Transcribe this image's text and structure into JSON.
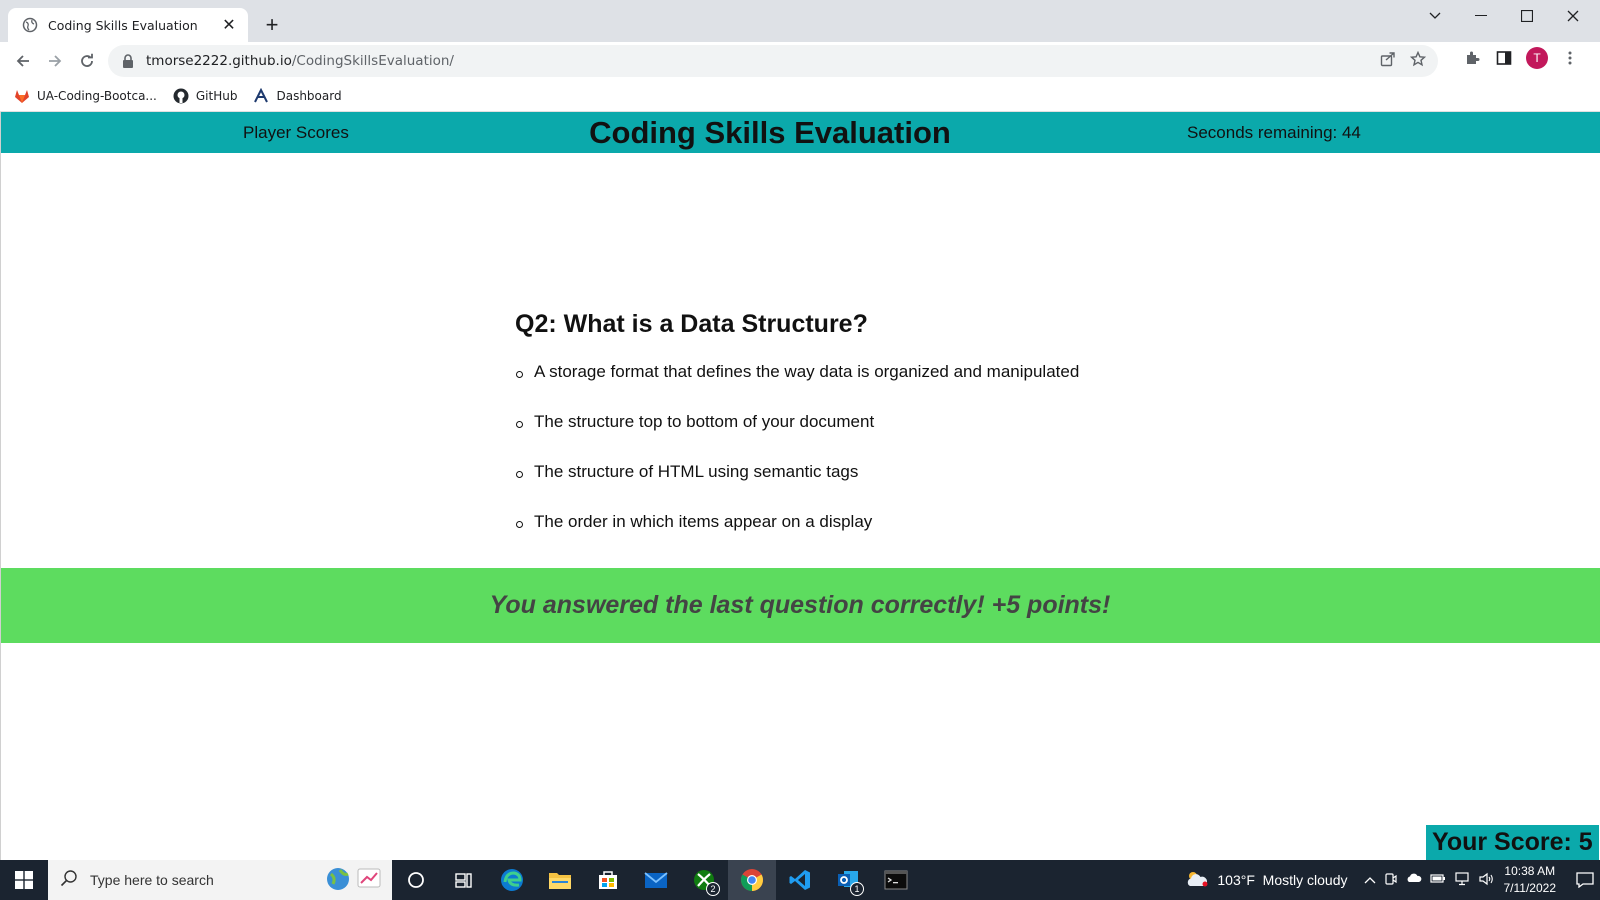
{
  "browser": {
    "tab_title": "Coding Skills Evaluation",
    "url_host": "tmorse2222.github.io",
    "url_path": "/CodingSkillsEvaluation/",
    "profile_initial": "T",
    "bookmarks": [
      {
        "label": "UA-Coding-Bootca...",
        "icon": "gitlab-icon"
      },
      {
        "label": "GitHub",
        "icon": "github-icon"
      },
      {
        "label": "Dashboard",
        "icon": "arizona-icon"
      }
    ]
  },
  "header": {
    "player_scores": "Player Scores",
    "title": "Coding Skills Evaluation",
    "timer": "Seconds remaining: 44"
  },
  "quiz": {
    "question": "Q2: What is a Data Structure?",
    "answers": [
      "A storage format that defines the way data is organized and manipulated",
      "The structure top to bottom of your document",
      "The structure of HTML using semantic tags",
      "The order in which items appear on a display"
    ],
    "feedback": "You answered the last question correctly! +5 points!",
    "score": "Your Score: 5"
  },
  "colors": {
    "header_bg": "#0ba9ab",
    "feedback_bg": "#5ddc5f"
  },
  "taskbar": {
    "search_placeholder": "Type here to search",
    "weather": "103°F  Mostly cloudy",
    "time": "10:38 AM",
    "date": "7/11/2022",
    "xbox_badge": "2",
    "outlook_badge": "1"
  }
}
